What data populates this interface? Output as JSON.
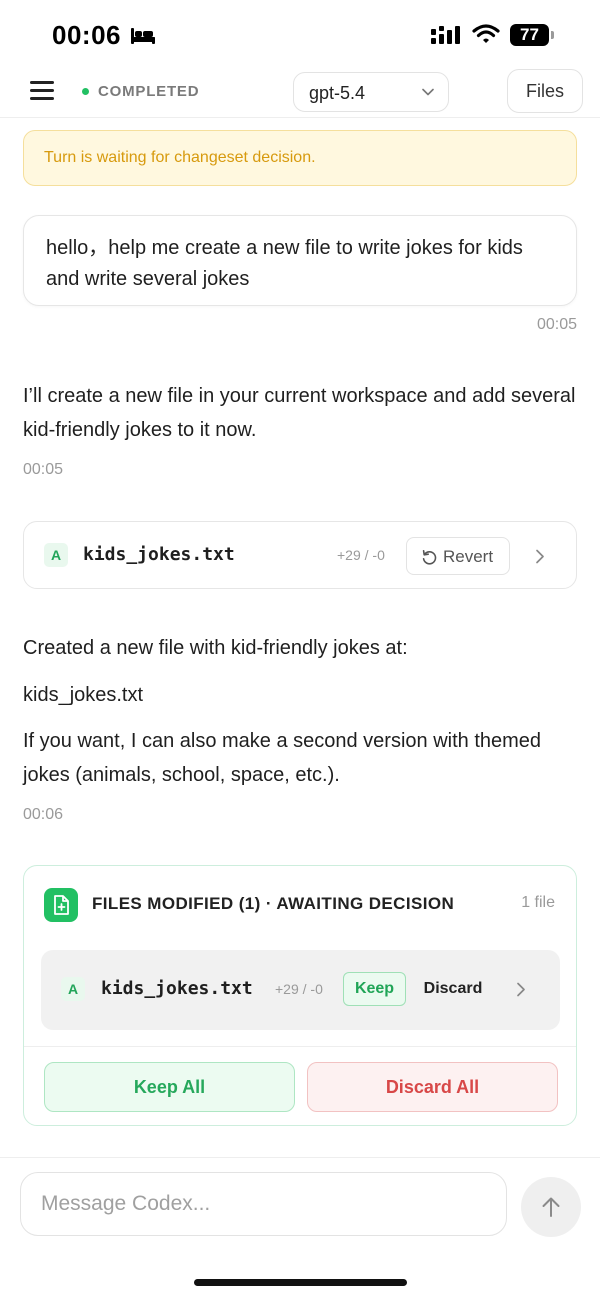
{
  "status_bar": {
    "time": "00:06",
    "battery": "77",
    "icons": [
      "bed-icon",
      "signal-icon",
      "wifi-icon",
      "battery-icon"
    ]
  },
  "header": {
    "status": "COMPLETED",
    "status_color": "#22c063",
    "model": "gpt-5.4",
    "files_label": "Files"
  },
  "banner": {
    "text": "Turn is waiting for changeset decision."
  },
  "conversation": {
    "user_message": "hello，help me create a new file to write jokes for kids and write several jokes",
    "user_time": "00:05",
    "assistant_1": "I’ll create a new file in your current workspace and add several kid-friendly jokes to it now.",
    "assistant_1_time": "00:05",
    "file_change": {
      "badge": "A",
      "name": "kids_jokes.txt",
      "diff": "+29 / -0",
      "revert_label": "Revert"
    },
    "assistant_2_p1": "Created a new file with kid-friendly jokes at:",
    "assistant_2_p2": "kids_jokes.txt",
    "assistant_2_p3": "If you want, I can also make a second version with themed jokes (animals, school, space, etc.).",
    "assistant_2_time": "00:06"
  },
  "modified_panel": {
    "title": "FILES MODIFIED (1) · AWAITING DECISION",
    "count": "1 file",
    "row": {
      "badge": "A",
      "name": "kids_jokes.txt",
      "diff": "+29 / -0",
      "keep_label": "Keep",
      "discard_label": "Discard"
    },
    "keep_all_label": "Keep All",
    "discard_all_label": "Discard All"
  },
  "composer": {
    "placeholder": "Message Codex..."
  },
  "colors": {
    "accent_green": "#22c063",
    "danger_red": "#d84848",
    "warning_amber": "#d79a0e"
  }
}
